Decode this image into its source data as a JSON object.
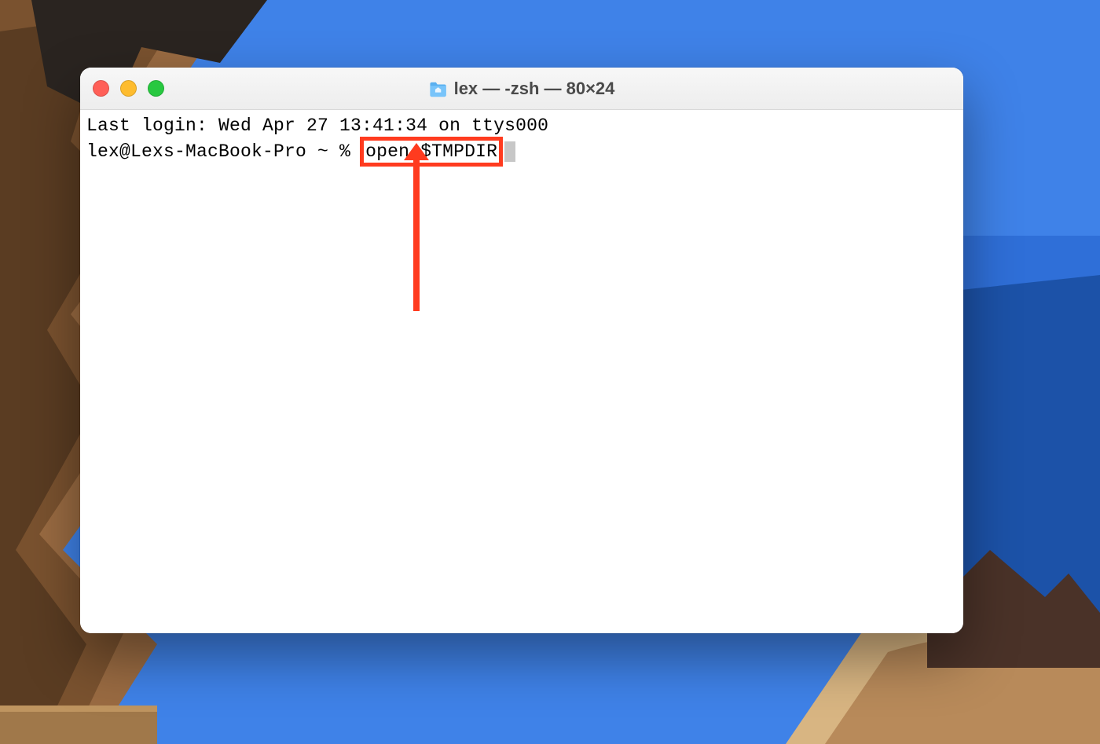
{
  "window": {
    "title": "lex — -zsh — 80×24"
  },
  "terminal": {
    "last_login_line": "Last login: Wed Apr 27 13:41:34 on ttys000",
    "prompt_prefix": "lex@Lexs-MacBook-Pro ~ % ",
    "command": "open $TMPDIR"
  },
  "annotation": {
    "highlight_color": "#ff3b1f"
  }
}
